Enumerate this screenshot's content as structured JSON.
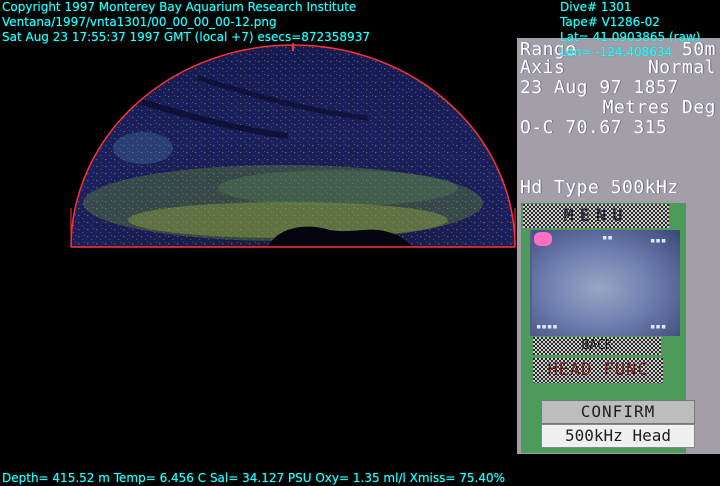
{
  "header_left": {
    "copyright": "Copyright 1997 Monterey Bay Aquarium Research Institute",
    "path": "Ventana/1997/vnta1301/00_00_00_00-12.png",
    "datetime": "Sat Aug 23 17:55:37 1997 GMT (local +7)  esecs=872358937"
  },
  "header_right": {
    "dive": "Dive# 1301",
    "tape": "Tape# V1286-02",
    "lat": "Lat= 41.0903865 (raw)",
    "lon": "Lon= -124.408634"
  },
  "sonar_panel": {
    "range_label": "Range",
    "range_value": "50m",
    "axis_label": "Axis",
    "axis_value": "Normal",
    "date": "23 Aug 97 1857",
    "units": "Metres Deg",
    "oc_line": "O-C 70.67 315",
    "head_type": "Hd Type 500kHz"
  },
  "menu": {
    "title": "MENU",
    "back_label": "BACK",
    "head_func_label": "HEAD FUNC",
    "confirm_label": "CONFIRM",
    "head_label": "500kHz Head"
  },
  "footer": {
    "sensors": "Depth= 415.52 m  Temp= 6.456 C  Sal= 34.127 PSU  Oxy= 1.35 ml/l  Xmiss= 75.40%"
  },
  "colors": {
    "overlay_text": "#22ffff",
    "sonar_outline": "#ff3030",
    "panel_bg": "#a39ea8",
    "menu_bg": "#4d9a5a"
  }
}
